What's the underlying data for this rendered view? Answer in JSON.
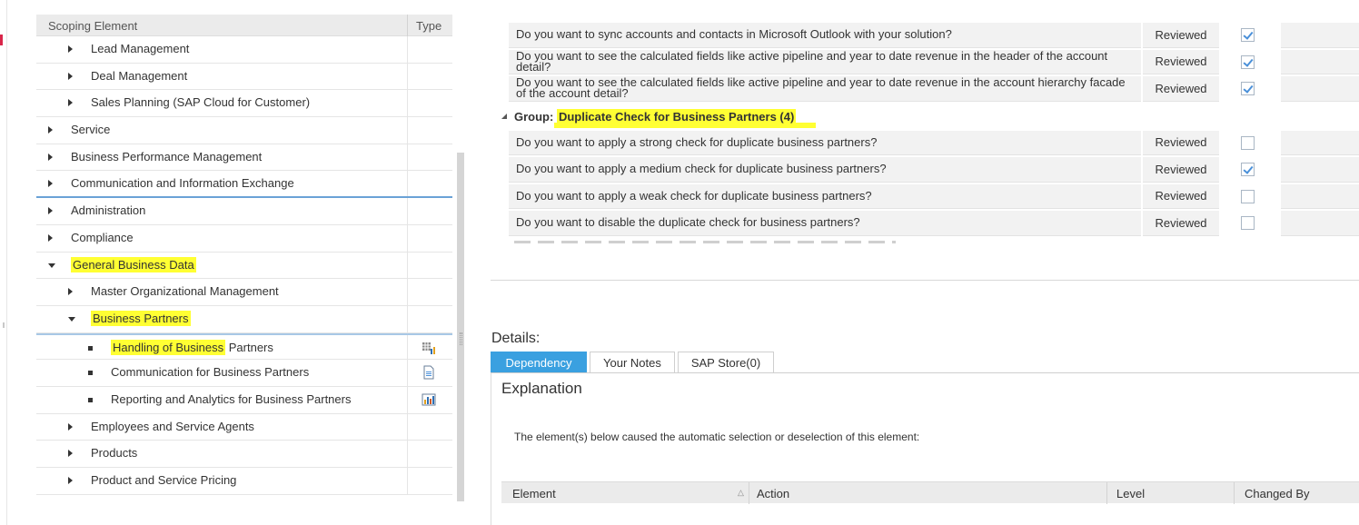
{
  "tree": {
    "header": {
      "col_element": "Scoping Element",
      "col_type": "Type"
    },
    "rows": [
      {
        "label": "Lead Management",
        "indent": 2,
        "marker": "arrow",
        "highlight": false,
        "type_icon": ""
      },
      {
        "label": "Deal Management",
        "indent": 2,
        "marker": "arrow",
        "highlight": false,
        "type_icon": ""
      },
      {
        "label": "Sales Planning (SAP Cloud for Customer)",
        "indent": 2,
        "marker": "arrow",
        "highlight": false,
        "type_icon": ""
      },
      {
        "label": "Service",
        "indent": 1,
        "marker": "arrow",
        "highlight": false,
        "type_icon": ""
      },
      {
        "label": "Business Performance Management",
        "indent": 1,
        "marker": "arrow",
        "highlight": false,
        "type_icon": ""
      },
      {
        "label": "Communication and Information Exchange",
        "indent": 1,
        "marker": "arrow",
        "highlight": false,
        "type_icon": ""
      },
      {
        "label": "Administration",
        "indent": 1,
        "marker": "arrow",
        "highlight": false,
        "type_icon": ""
      },
      {
        "label": "Compliance",
        "indent": 1,
        "marker": "arrow",
        "highlight": false,
        "type_icon": ""
      },
      {
        "label": "General Business Data",
        "indent": 1,
        "marker": "arrow-down",
        "highlight": true,
        "type_icon": ""
      },
      {
        "label": "Master Organizational Management",
        "indent": 2,
        "marker": "arrow",
        "highlight": false,
        "type_icon": ""
      },
      {
        "label": "Business Partners",
        "indent": 2,
        "marker": "arrow-down",
        "highlight": true,
        "type_icon": ""
      },
      {
        "label": "Handling of Business Partners",
        "indent": 3,
        "marker": "bullet",
        "highlight": "partial",
        "type_icon": "table-chart-icon"
      },
      {
        "label": "Communication for Business Partners",
        "indent": 3,
        "marker": "bullet",
        "highlight": false,
        "type_icon": "document-icon"
      },
      {
        "label": "Reporting and Analytics for Business Partners",
        "indent": 3,
        "marker": "bullet",
        "highlight": false,
        "type_icon": "bar-chart-icon"
      },
      {
        "label": "Employees and Service Agents",
        "indent": 2,
        "marker": "arrow",
        "highlight": false,
        "type_icon": ""
      },
      {
        "label": "Products",
        "indent": 2,
        "marker": "arrow",
        "highlight": false,
        "type_icon": ""
      },
      {
        "label": "Product and Service Pricing",
        "indent": 2,
        "marker": "arrow",
        "highlight": false,
        "type_icon": ""
      }
    ],
    "handling_hl_part": "Handling of Business",
    "handling_rest_part": " Partners"
  },
  "questions": {
    "rows_top": [
      {
        "question": "Do you want to sync accounts and contacts in Microsoft Outlook with your solution?",
        "status": "Reviewed",
        "checked": true
      },
      {
        "question": "Do you want to see the calculated fields like active pipeline and year to date revenue in the header of the account detail?",
        "status": "Reviewed",
        "checked": true
      },
      {
        "question": "Do you want to see the calculated fields like active pipeline and year to date revenue in the account hierarchy facade of the account detail?",
        "status": "Reviewed",
        "checked": true
      }
    ],
    "group_prefix": "Group: ",
    "group_name": "Duplicate Check for Business Partners (4)",
    "rows_group": [
      {
        "question": "Do you want to apply a strong check for duplicate business partners?",
        "status": "Reviewed",
        "checked": false
      },
      {
        "question": "Do you want to apply a medium check for duplicate business partners?",
        "status": "Reviewed",
        "checked": true
      },
      {
        "question": "Do you want to apply a weak check for duplicate business partners?",
        "status": "Reviewed",
        "checked": false
      },
      {
        "question": "Do you want to disable the duplicate check for business partners?",
        "status": "Reviewed",
        "checked": false
      }
    ]
  },
  "details": {
    "title": "Details:",
    "tabs": [
      "Dependency",
      "Your Notes",
      "SAP Store(0)"
    ],
    "explanation_title": "Explanation",
    "explanation_text": "The element(s) below caused the automatic selection or deselection of this element:",
    "columns": {
      "element": "Element",
      "action": "Action",
      "level": "Level",
      "changed_by": "Changed By"
    }
  },
  "colors": {
    "highlight": "#ffff33",
    "active_tab": "#3aa0e0",
    "check": "#4a90d9"
  }
}
